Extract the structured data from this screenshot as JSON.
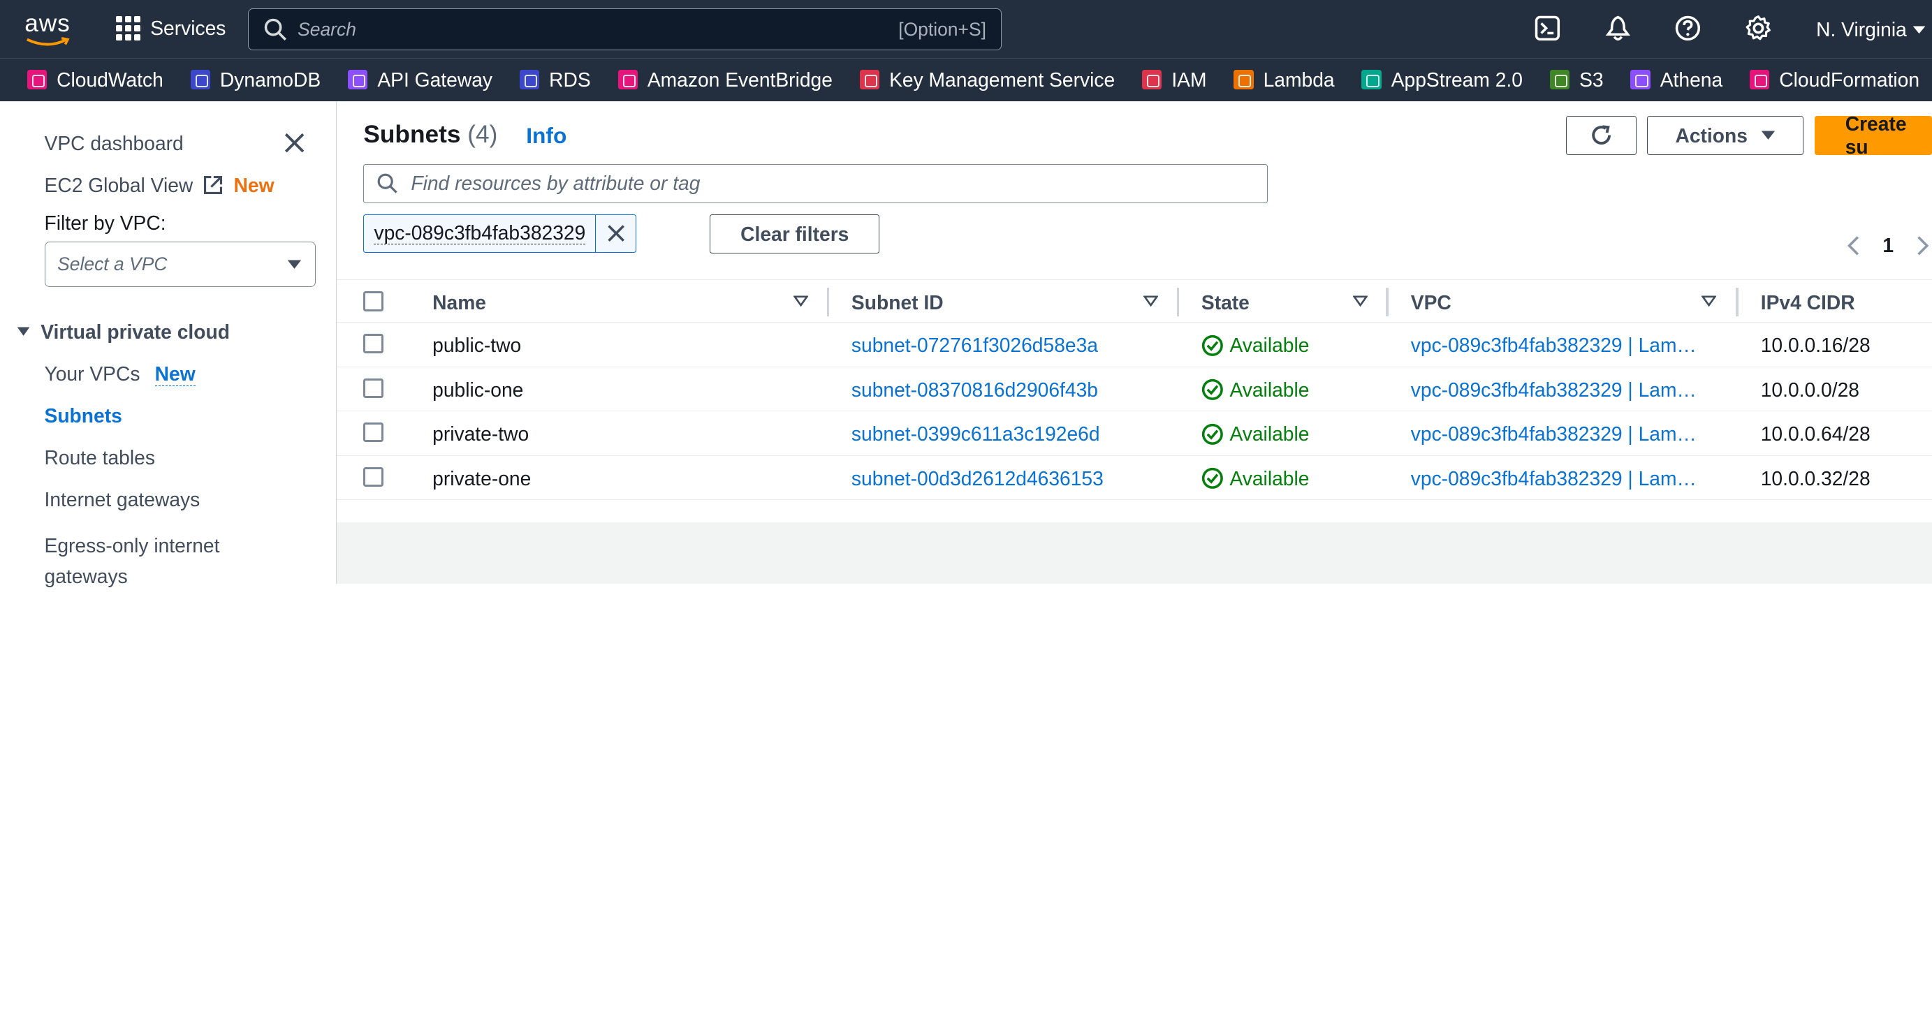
{
  "topbar": {
    "logo_text": "aws",
    "services_label": "Services",
    "search_placeholder": "Search",
    "search_shortcut": "[Option+S]",
    "region": "N. Virginia"
  },
  "favorites": [
    {
      "label": "CloudWatch",
      "color": "#e7157b"
    },
    {
      "label": "DynamoDB",
      "color": "#3b48cc"
    },
    {
      "label": "API Gateway",
      "color": "#8c4fff"
    },
    {
      "label": "RDS",
      "color": "#3b48cc"
    },
    {
      "label": "Amazon EventBridge",
      "color": "#e7157b"
    },
    {
      "label": "Key Management Service",
      "color": "#dd344c"
    },
    {
      "label": "IAM",
      "color": "#dd344c"
    },
    {
      "label": "Lambda",
      "color": "#ed7100"
    },
    {
      "label": "AppStream 2.0",
      "color": "#01a88d"
    },
    {
      "label": "S3",
      "color": "#3f8624"
    },
    {
      "label": "Athena",
      "color": "#8c4fff"
    },
    {
      "label": "CloudFormation",
      "color": "#e7157b"
    }
  ],
  "sidebar": {
    "dashboard": "VPC dashboard",
    "ec2_global": "EC2 Global View",
    "ec2_badge": "New",
    "filter_label": "Filter by VPC:",
    "select_placeholder": "Select a VPC",
    "section": "Virtual private cloud",
    "your_vpcs": "Your VPCs",
    "your_vpcs_badge": "New",
    "subnets": "Subnets",
    "route_tables": "Route tables",
    "internet_gateways": "Internet gateways",
    "egress_line1": "Egress-only internet",
    "egress_line2": "gateways"
  },
  "main": {
    "title": "Subnets",
    "count": "(4)",
    "info": "Info",
    "actions": "Actions",
    "create": "Create su",
    "find_placeholder": "Find resources by attribute or tag",
    "filter_token": "vpc-089c3fb4fab382329",
    "clear_filters": "Clear filters",
    "page": "1"
  },
  "table": {
    "columns": [
      "Name",
      "Subnet ID",
      "State",
      "VPC",
      "IPv4 CIDR"
    ],
    "rows": [
      {
        "name": "public-two",
        "subnet_id": "subnet-072761f3026d58e3a",
        "state": "Available",
        "vpc": "vpc-089c3fb4fab382329 | Lam…",
        "cidr": "10.0.0.16/28"
      },
      {
        "name": "public-one",
        "subnet_id": "subnet-08370816d2906f43b",
        "state": "Available",
        "vpc": "vpc-089c3fb4fab382329 | Lam…",
        "cidr": "10.0.0.0/28"
      },
      {
        "name": "private-two",
        "subnet_id": "subnet-0399c611a3c192e6d",
        "state": "Available",
        "vpc": "vpc-089c3fb4fab382329 | Lam…",
        "cidr": "10.0.0.64/28"
      },
      {
        "name": "private-one",
        "subnet_id": "subnet-00d3d2612d4636153",
        "state": "Available",
        "vpc": "vpc-089c3fb4fab382329 | Lam…",
        "cidr": "10.0.0.32/28"
      }
    ]
  },
  "colors": {
    "nav_bg": "#232f3e",
    "link": "#0972d3",
    "primary": "#ff9900",
    "success": "#037f0c",
    "new_badge": "#ec7211"
  }
}
